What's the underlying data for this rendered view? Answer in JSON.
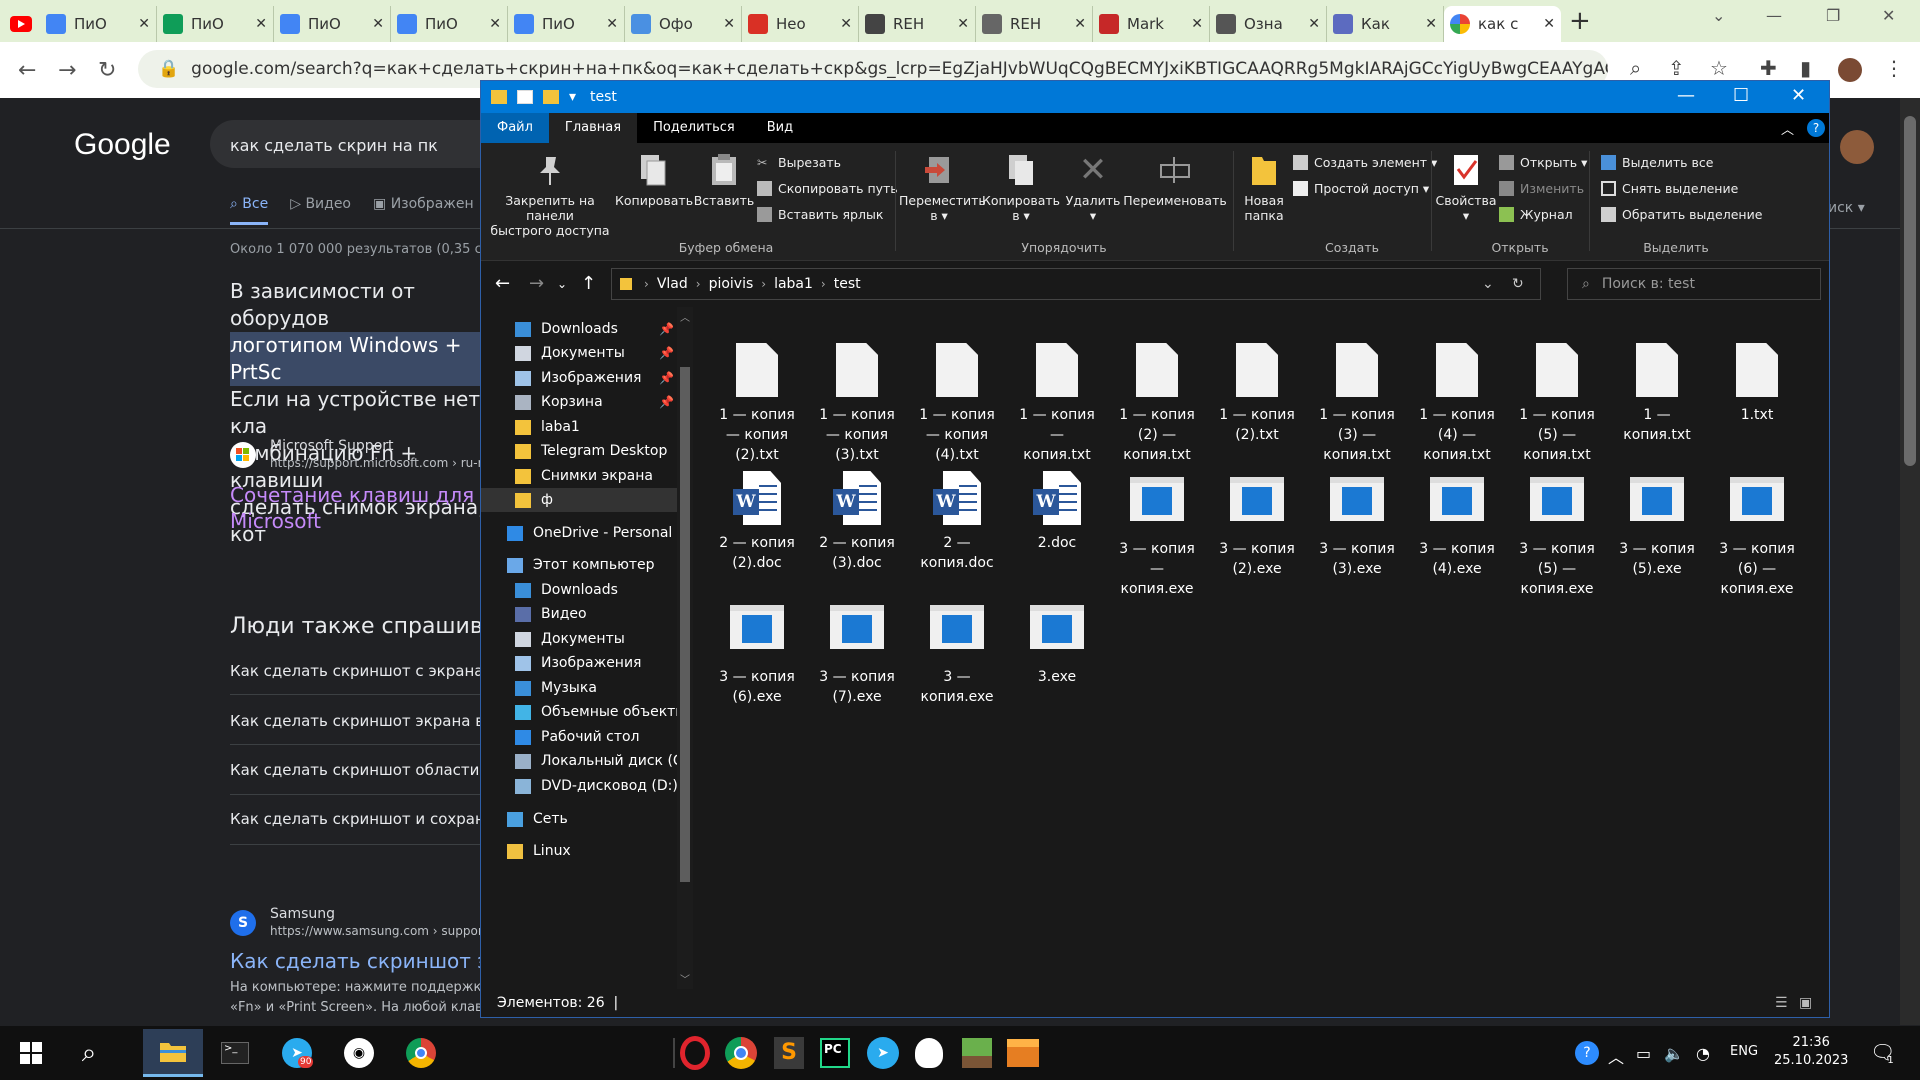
{
  "chrome": {
    "tabs": [
      {
        "title": "ПиО",
        "color": "#4285f4"
      },
      {
        "title": "ПиО",
        "color": "#0f9d58"
      },
      {
        "title": "ПиО",
        "color": "#4285f4"
      },
      {
        "title": "ПиО",
        "color": "#4285f4"
      },
      {
        "title": "ПиО",
        "color": "#4285f4"
      },
      {
        "title": "Офо",
        "color": "#4a90e2"
      },
      {
        "title": "Нео",
        "color": "#d93025"
      },
      {
        "title": "REH",
        "color": "#444444"
      },
      {
        "title": "REH",
        "color": "#666666"
      },
      {
        "title": "Mark",
        "color": "#c62828"
      },
      {
        "title": "Озна",
        "color": "#555555"
      },
      {
        "title": "Как",
        "color": "#5c6bc0"
      },
      {
        "title": "как с",
        "color": "#ffffff"
      }
    ],
    "url": "google.com/search?q=как+сделать+скрин+на+пк&oq=как+сделать+скр&gs_lcrp=EgZjaHJvbWUqCQgBECMYJxiKBTIGCAAQRRg5MgkIARAjGCcYigUyBwgCEAAYgAQyBwgDEAAY..."
  },
  "google": {
    "logo": "Google",
    "query": "как сделать скрин на пк",
    "tabs": [
      "Все",
      "Видео",
      "Изображен"
    ],
    "count": "Около 1 070 000 результатов (0,35 сек",
    "snippet_lines": [
      "В зависимости от оборудов",
      "логотипом Windows + PrtSc",
      "Если на устройстве нет кла",
      "комбинацию Fn + клавиши",
      "сделать снимок экрана, кот"
    ],
    "src1_name": "Microsoft Support",
    "src1_url": "https://support.microsoft.com › ru-ru ›",
    "link1_a": "Сочетание клавиш для экра",
    "link1_b": "Microsoft",
    "paa_title": "Люди также спрашивают",
    "paa": [
      "Как сделать скриншот с экрана ко",
      "Как сделать скриншот экрана в W",
      "Как сделать скриншот области в W",
      "Как сделать скриншот и сохранит"
    ],
    "src2_name": "Samsung",
    "src2_url": "https://www.samsung.com › support",
    "link2": "Как сделать скриншот экра",
    "desc1": "На компьютере: нажмите поддержку «",
    "desc2": "«Fn» и «Print Screen». На любой клави",
    "right_menu": "иск"
  },
  "explorer": {
    "title": "test",
    "ribbon_tabs": [
      "Файл",
      "Главная",
      "Поделиться",
      "Вид"
    ],
    "pin_line1": "Закрепить на панели",
    "pin_line2": "быстрого доступа",
    "copy": "Копировать",
    "paste": "Вставить",
    "cut": "Вырезать",
    "copy_path": "Скопировать путь",
    "paste_shortcut": "Вставить ярлык",
    "group_clipboard": "Буфер обмена",
    "move_to1": "Переместить",
    "move_to2": "в",
    "copy_to1": "Копировать",
    "copy_to2": "в",
    "delete": "Удалить",
    "rename": "Переименовать",
    "group_organize": "Упорядочить",
    "new_folder1": "Новая",
    "new_folder2": "папка",
    "new_item": "Создать элемент",
    "easy_access": "Простой доступ",
    "group_new": "Создать",
    "properties": "Свойства",
    "open": "Открыть",
    "edit": "Изменить",
    "history": "Журнал",
    "group_open": "Открыть",
    "select_all": "Выделить все",
    "select_none": "Снять выделение",
    "invert_sel": "Обратить выделение",
    "group_select": "Выделить",
    "path": [
      "Vlad",
      "pioivis",
      "laba1",
      "test"
    ],
    "search_placeholder": "Поиск в: test",
    "nav": [
      {
        "label": "Downloads",
        "pin": true,
        "icon": "download"
      },
      {
        "label": "Документы",
        "pin": true,
        "icon": "docs"
      },
      {
        "label": "Изображения",
        "pin": true,
        "icon": "pics"
      },
      {
        "label": "Корзина",
        "pin": true,
        "icon": "bin"
      },
      {
        "label": "laba1",
        "pin": false,
        "icon": "folder"
      },
      {
        "label": "Telegram Desktop",
        "pin": false,
        "icon": "folder"
      },
      {
        "label": "Снимки экрана",
        "pin": false,
        "icon": "folder"
      },
      {
        "label": "ф",
        "pin": false,
        "icon": "folder"
      },
      {
        "label": "OneDrive - Personal",
        "pin": false,
        "icon": "cloud"
      },
      {
        "label": "Этот компьютер",
        "pin": false,
        "icon": "pc"
      },
      {
        "label": "Downloads",
        "pin": false,
        "icon": "download"
      },
      {
        "label": "Видео",
        "pin": false,
        "icon": "video"
      },
      {
        "label": "Документы",
        "pin": false,
        "icon": "docs"
      },
      {
        "label": "Изображения",
        "pin": false,
        "icon": "pics"
      },
      {
        "label": "Музыка",
        "pin": false,
        "icon": "music"
      },
      {
        "label": "Объемные объекты",
        "pin": false,
        "icon": "cube"
      },
      {
        "label": "Рабочий стол",
        "pin": false,
        "icon": "desktop"
      },
      {
        "label": "Локальный диск (C",
        "pin": false,
        "icon": "disk"
      },
      {
        "label": "DVD-дисковод (D:)",
        "pin": false,
        "icon": "dvd"
      },
      {
        "label": "Сеть",
        "pin": false,
        "icon": "net"
      },
      {
        "label": "Linux",
        "pin": false,
        "icon": "linux"
      }
    ],
    "files": [
      {
        "name": [
          "1 — копия",
          "— копия",
          "(2).txt"
        ],
        "type": "txt"
      },
      {
        "name": [
          "1 — копия",
          "— копия",
          "(3).txt"
        ],
        "type": "txt"
      },
      {
        "name": [
          "1 — копия",
          "— копия",
          "(4).txt"
        ],
        "type": "txt"
      },
      {
        "name": [
          "1 — копия",
          "—",
          "копия.txt"
        ],
        "type": "txt"
      },
      {
        "name": [
          "1 — копия",
          "(2) —",
          "копия.txt"
        ],
        "type": "txt"
      },
      {
        "name": [
          "1 — копия",
          "(2).txt"
        ],
        "type": "txt"
      },
      {
        "name": [
          "1 — копия",
          "(3) —",
          "копия.txt"
        ],
        "type": "txt"
      },
      {
        "name": [
          "1 — копия",
          "(4) —",
          "копия.txt"
        ],
        "type": "txt"
      },
      {
        "name": [
          "1 — копия",
          "(5) —",
          "копия.txt"
        ],
        "type": "txt"
      },
      {
        "name": [
          "1 —",
          "копия.txt"
        ],
        "type": "txt"
      },
      {
        "name": [
          "1.txt"
        ],
        "type": "txt"
      },
      {
        "name": [
          "2 — копия",
          "(2).doc"
        ],
        "type": "doc"
      },
      {
        "name": [
          "2 — копия",
          "(3).doc"
        ],
        "type": "doc"
      },
      {
        "name": [
          "2 —",
          "копия.doc"
        ],
        "type": "doc"
      },
      {
        "name": [
          "2.doc"
        ],
        "type": "doc"
      },
      {
        "name": [
          "3 — копия",
          "—",
          "копия.exe"
        ],
        "type": "exe"
      },
      {
        "name": [
          "3 — копия",
          "(2).exe"
        ],
        "type": "exe"
      },
      {
        "name": [
          "3 — копия",
          "(3).exe"
        ],
        "type": "exe"
      },
      {
        "name": [
          "3 — копия",
          "(4).exe"
        ],
        "type": "exe"
      },
      {
        "name": [
          "3 — копия",
          "(5) —",
          "копия.exe"
        ],
        "type": "exe"
      },
      {
        "name": [
          "3 — копия",
          "(5).exe"
        ],
        "type": "exe"
      },
      {
        "name": [
          "3 — копия",
          "(6) —",
          "копия.exe"
        ],
        "type": "exe"
      },
      {
        "name": [
          "3 — копия",
          "(6).exe"
        ],
        "type": "exe"
      },
      {
        "name": [
          "3 — копия",
          "(7).exe"
        ],
        "type": "exe"
      },
      {
        "name": [
          "3 —",
          "копия.exe"
        ],
        "type": "exe"
      },
      {
        "name": [
          "3.exe"
        ],
        "type": "exe"
      }
    ],
    "status": "Элементов: 26"
  },
  "taskbar": {
    "lang": "ENG",
    "time": "21:36",
    "date": "25.10.2023",
    "telegram_badge": "90",
    "notif_count": "1"
  }
}
